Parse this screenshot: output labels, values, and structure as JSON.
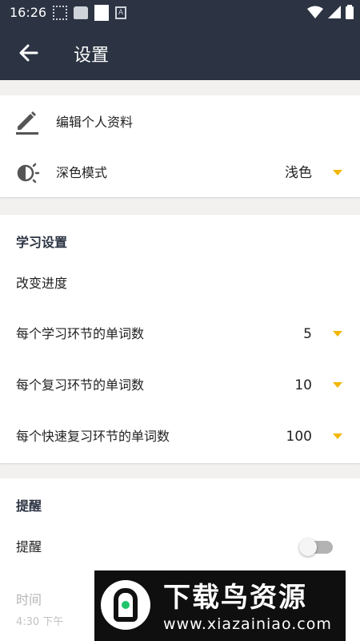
{
  "status_bar": {
    "time": "16:26"
  },
  "app_bar": {
    "title": "设置"
  },
  "profile_section": {
    "edit_profile": "编辑个人资料",
    "dark_mode_label": "深色模式",
    "dark_mode_value": "浅色"
  },
  "study_section": {
    "title": "学习设置",
    "change_progress": "改变进度",
    "items": [
      {
        "label": "每个学习环节的单词数",
        "value": "5"
      },
      {
        "label": "每个复习环节的单词数",
        "value": "10"
      },
      {
        "label": "每个快速复习环节的单词数",
        "value": "100"
      }
    ]
  },
  "reminder_section": {
    "title": "提醒",
    "reminder_label": "提醒",
    "reminder_enabled": false,
    "time_label": "时间",
    "time_value": "4:30 下午"
  },
  "watermark": {
    "title": "下载鸟资源",
    "url": "www.xiazainiao.com"
  },
  "colors": {
    "header_bg": "#2c3443",
    "accent": "#f2b705",
    "background": "#f3f1ef"
  }
}
